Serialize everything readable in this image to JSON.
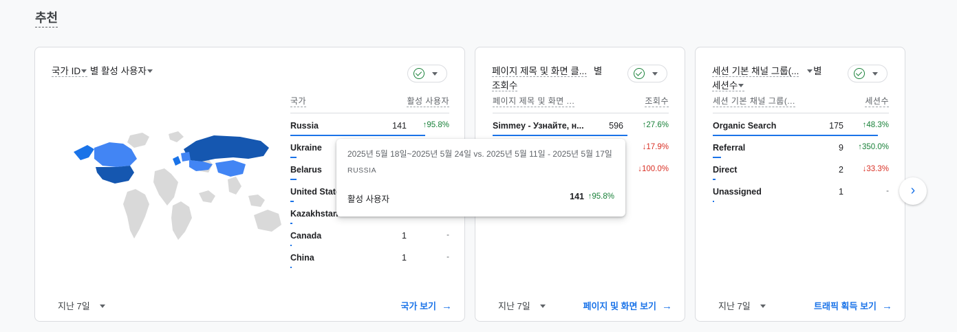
{
  "section": {
    "title": "추천"
  },
  "cards": [
    {
      "title_dim": "국가 ID",
      "title_mid": " 별 활성 사용자",
      "col_dim": "국가",
      "col_metric": "활성 사용자",
      "rows": [
        {
          "name": "Russia",
          "value": "141",
          "change": "95.8%",
          "dir": "up",
          "share": 0.88
        },
        {
          "name": "Ukraine",
          "value": "",
          "change": "",
          "dir": "none",
          "share": 0.04
        },
        {
          "name": "Belarus",
          "value": "",
          "change": "",
          "dir": "none",
          "share": 0.04
        },
        {
          "name": "United States",
          "value": "",
          "change": "",
          "dir": "none",
          "share": 0.02
        },
        {
          "name": "Kazakhstan",
          "value": "",
          "change": "",
          "dir": "none",
          "share": 0.01
        },
        {
          "name": "Canada",
          "value": "1",
          "change": "-",
          "dir": "none",
          "share": 0.01
        },
        {
          "name": "China",
          "value": "1",
          "change": "-",
          "dir": "none",
          "share": 0.01
        }
      ],
      "period": "지난 7일",
      "link": "국가 보기"
    },
    {
      "title_line1": "페이지 제목 및 화면 클...",
      "title_by": "별",
      "title_line2": "조회수",
      "col_dim": "페이지 제목 및 화면 ...",
      "col_metric": "조회수",
      "rows": [
        {
          "name": "Simmey - Узнайте, н...",
          "value": "596",
          "change": "27.6%",
          "dir": "up",
          "share": 0.88
        },
        {
          "name": "",
          "value": "",
          "change": "17.9%",
          "dir": "down",
          "share": 0
        },
        {
          "name": "",
          "value": "",
          "change": "100.0%",
          "dir": "down",
          "share": 0
        }
      ],
      "period": "지난 7일",
      "link": "페이지 및 화면 보기"
    },
    {
      "title_line1": "세션 기본 채널 그룹(...",
      "title_by": "별",
      "title_line2": "세션수",
      "col_dim": "세션 기본 채널 그룹(...",
      "col_metric": "세션수",
      "rows": [
        {
          "name": "Organic Search",
          "value": "175",
          "change": "48.3%",
          "dir": "up",
          "share": 0.92
        },
        {
          "name": "Referral",
          "value": "9",
          "change": "350.0%",
          "dir": "up",
          "share": 0.05
        },
        {
          "name": "Direct",
          "value": "2",
          "change": "33.3%",
          "dir": "down",
          "share": 0.015
        },
        {
          "name": "Unassigned",
          "value": "1",
          "change": "-",
          "dir": "none",
          "share": 0.005
        }
      ],
      "period": "지난 7일",
      "link": "트래픽 획득 보기"
    }
  ],
  "tooltip": {
    "dates": "2025년 5월 18일~2025년 5월 24일 vs. 2025년 5월 11일 - 2025년 5월 17일",
    "country": "RUSSIA",
    "metric": "활성 사용자",
    "value": "141",
    "change": "95.8%"
  },
  "colors": {
    "accent": "#1a73e8",
    "up": "#188038",
    "down": "#d93025"
  }
}
